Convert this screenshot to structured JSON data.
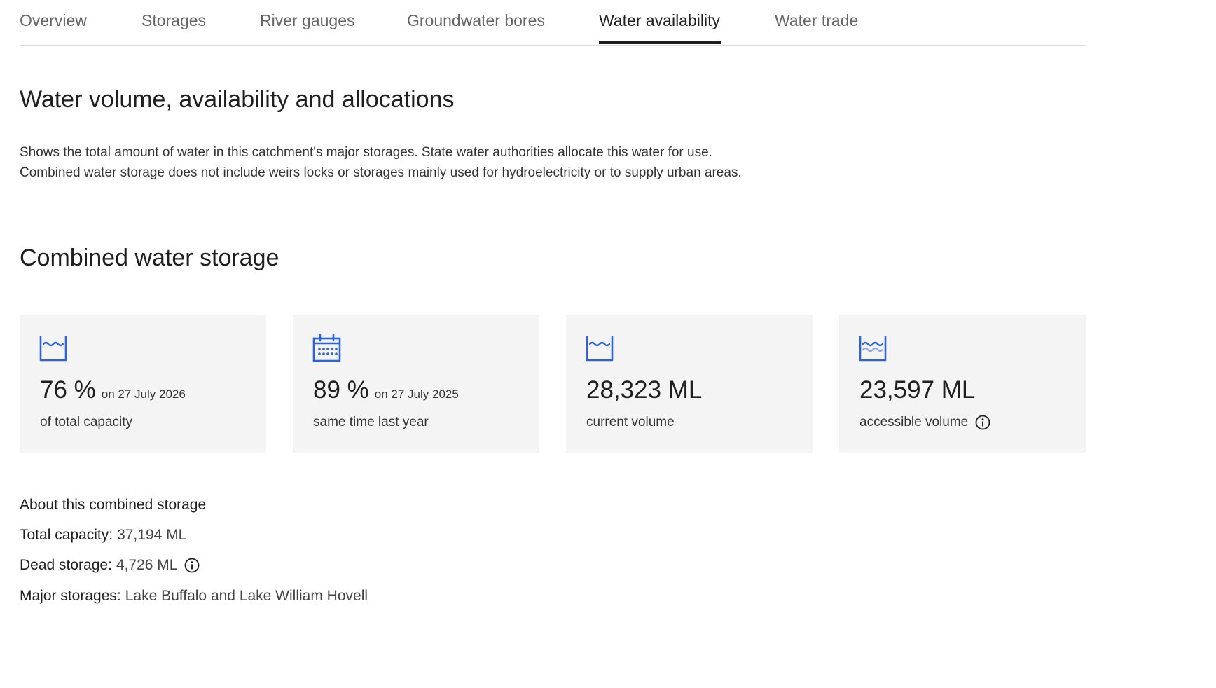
{
  "tabs": [
    {
      "label": "Overview",
      "active": false
    },
    {
      "label": "Storages",
      "active": false
    },
    {
      "label": "River gauges",
      "active": false
    },
    {
      "label": "Groundwater bores",
      "active": false
    },
    {
      "label": "Water availability",
      "active": true
    },
    {
      "label": "Water trade",
      "active": false
    }
  ],
  "page": {
    "title": "Water volume, availability and allocations",
    "intro": "Shows the total amount of water in this catchment's major storages. State water authorities allocate this water for use. Combined water storage does not include weirs locks or storages mainly used for hydroelectricity or to supply urban areas."
  },
  "combined": {
    "title": "Combined water storage",
    "cards": [
      {
        "icon": "water-tank-icon",
        "value": "76 %",
        "date": "on 27 July 2026",
        "caption": "of total capacity"
      },
      {
        "icon": "calendar-icon",
        "value": "89 %",
        "date": "on 27 July 2025",
        "caption": "same time last year"
      },
      {
        "icon": "water-tank-icon",
        "value": "28,323 ML",
        "caption": "current volume"
      },
      {
        "icon": "water-waves-icon",
        "value": "23,597 ML",
        "caption": "accessible volume",
        "info": true
      }
    ]
  },
  "about": {
    "title": "About this combined storage",
    "total_capacity_label": "Total capacity:",
    "total_capacity_value": "37,194 ML",
    "dead_storage_label": "Dead storage:",
    "dead_storage_value": "4,726 ML",
    "major_storages_label": "Major storages:",
    "major_storages_value": "Lake Buffalo and Lake William Hovell"
  },
  "colors": {
    "icon_blue": "#2b63d9",
    "active_tab": "#1f1f1f",
    "card_background": "#f4f4f4"
  }
}
